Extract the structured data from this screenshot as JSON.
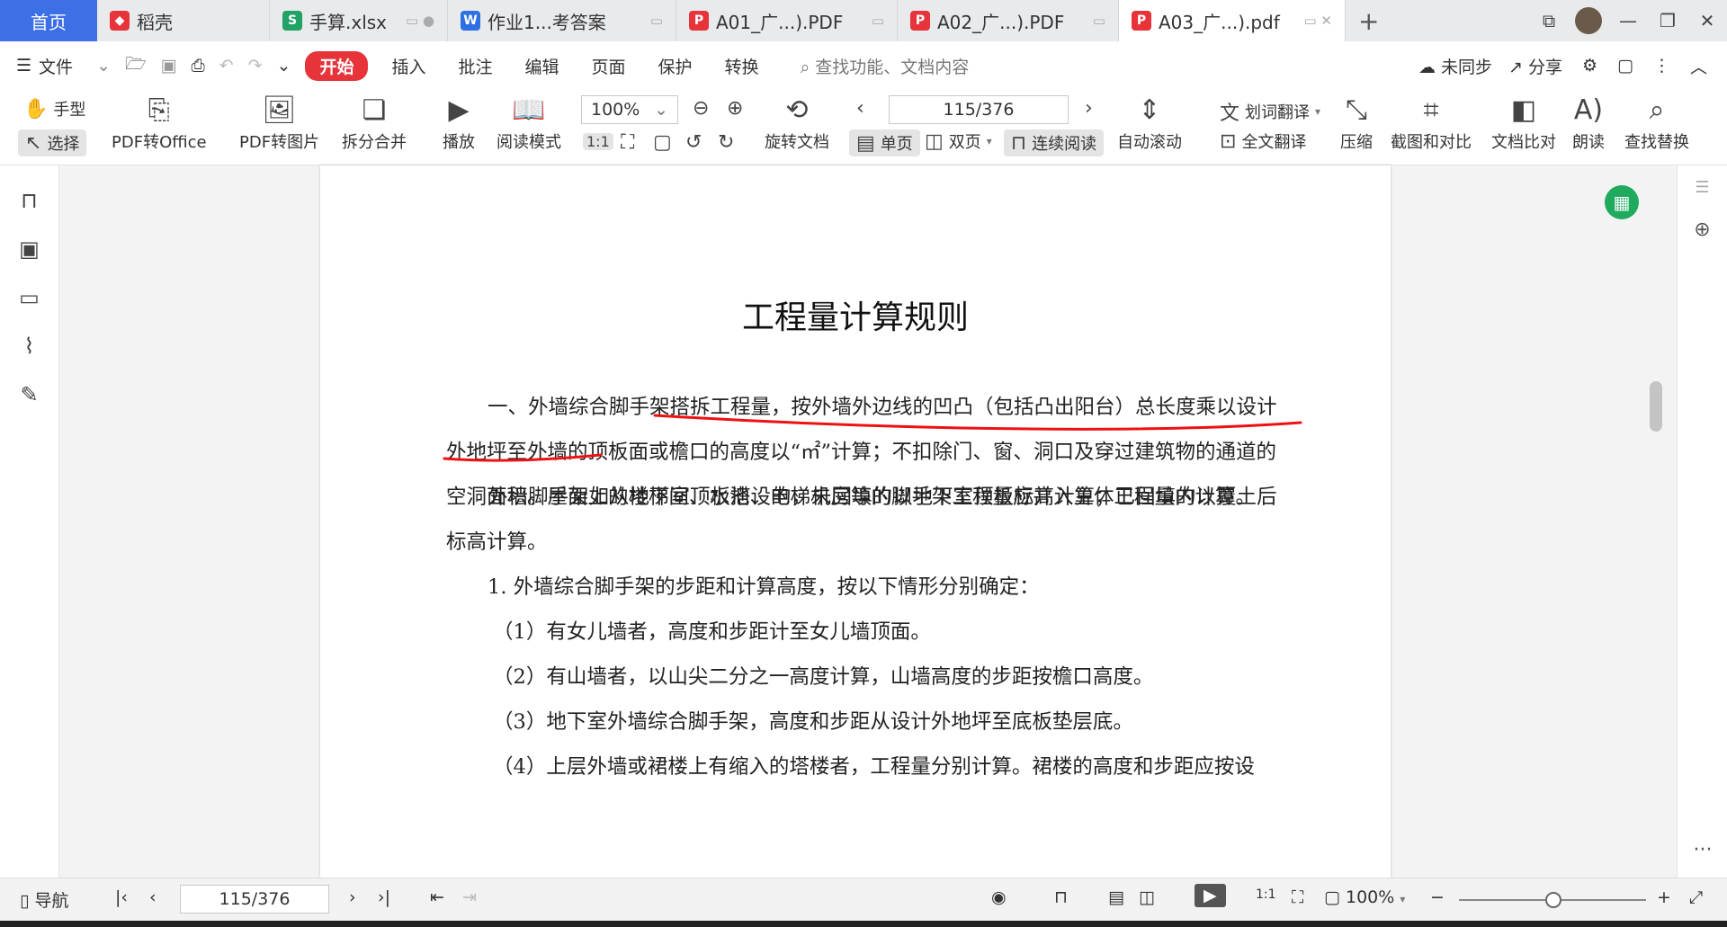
{
  "tabs": [
    {
      "label": "首页"
    },
    {
      "label": "稻壳"
    },
    {
      "label": "手算.xlsx"
    },
    {
      "label": "作业1...考答案"
    },
    {
      "label": "A01_广...).PDF"
    },
    {
      "label": "A02_广...).PDF"
    },
    {
      "label": "A03_广...).pdf"
    }
  ],
  "menu": {
    "file": "文件",
    "items": [
      "开始",
      "插入",
      "批注",
      "编辑",
      "页面",
      "保护",
      "转换"
    ],
    "search_placeholder": "查找功能、文档内容",
    "sync": "未同步",
    "share": "分享"
  },
  "toolbar": {
    "hand": "手型",
    "select": "选择",
    "pdf_to_office": "PDF转Office",
    "pdf_to_image": "PDF转图片",
    "split_merge": "拆分合并",
    "play": "播放",
    "read_mode": "阅读模式",
    "zoom": "100%",
    "rotate_doc": "旋转文档",
    "page_input": "115/376",
    "single": "单页",
    "double": "双页",
    "continuous": "连续阅读",
    "auto_scroll": "自动滚动",
    "word_translate": "划词翻译",
    "full_translate": "全文翻译",
    "compress": "压缩",
    "screenshot_compare": "截图和对比",
    "doc_compare": "文档比对",
    "read_aloud": "朗读",
    "find_replace": "查找替换"
  },
  "document": {
    "title": "工程量计算规则",
    "p1_a": "一、外墙综合脚手架搭拆工程量，按外墙外边线的凹凸（包括凸出阳台）总长度乘以设计外地坪至外墙的顶板面或檐口的高度以“㎡”计算；不扣除门、窗、洞口及穿过建筑物的通道的空洞面积。",
    "p1_b": "屋面上的楼梯间、水池、电梯机房等的脚手架工程量应并入主体工程量内计算。",
    "p2": "外墙脚手架如从地下室顶板搭设的，未回填的以地下室顶板标高计算；已回填的以覆土后标高计算。",
    "p3": "1. 外墙综合脚手架的步距和计算高度，按以下情形分别确定：",
    "p4": "（1）有女儿墙者，高度和步距计至女儿墙顶面。",
    "p5": "（2）有山墙者，以山尖二分之一高度计算，山墙高度的步距按檐口高度。",
    "p6": "（3）地下室外墙综合脚手架，高度和步距从设计外地坪至底板垫层底。",
    "p7": "（4）上层外墙或裙楼上有缩入的塔楼者，工程量分别计算。裙楼的高度和步距应按设"
  },
  "status": {
    "nav": "导航",
    "page": "115/376",
    "zoom": "100%"
  },
  "colors": {
    "accent": "#3d6fe6",
    "start": "#e6343a",
    "annotation": "#e11"
  }
}
